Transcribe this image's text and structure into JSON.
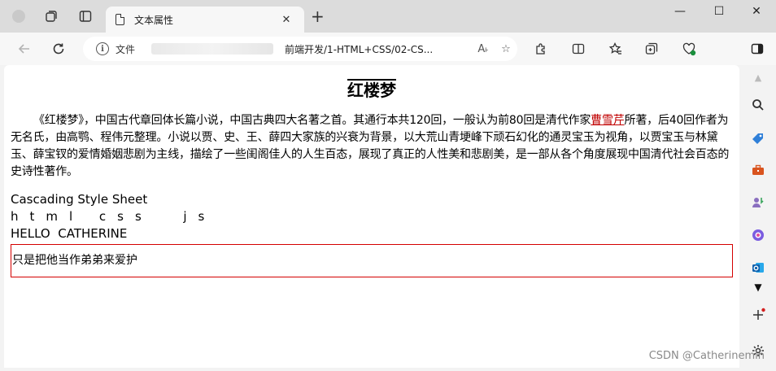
{
  "browser": {
    "tab_title": "文本属性",
    "tab_close": "✕",
    "new_tab": "+",
    "omnibox": {
      "security_label": "文件",
      "url_visible": "前端开发/1-HTML+CSS/02-CS...",
      "read_aloud": "A˫",
      "favorite": "☆"
    },
    "window_controls": {
      "minimize": "—",
      "maximize": "☐",
      "close": "✕"
    }
  },
  "page": {
    "title": "红楼梦",
    "intro_text": "《红楼梦》，中国古代章回体长篇小说，中国古典四大名著之首。其通行本共120回，一般认为前80回是清代作家",
    "intro_link": "曹雪芹",
    "intro_rest": "所著，后40回作者为无名氏，由高鹗、程伟元整理。小说以贾、史、王、薛四大家族的兴衰为背景，以大荒山青埂峰下顽石幻化的通灵宝玉为视角，以贾宝玉与林黛玉、薛宝钗的爱情婚姻悲剧为主线，描绘了一些闺阁佳人的人生百态，展现了真正的人性美和悲剧美，是一部从各个角度展现中国清代社会百态的史诗性著作。",
    "line_css": "Cascading Style Sheet",
    "line_spaced": "html css  js",
    "line_upper": "HELLO  CATHERINE",
    "boxed_text": "只是把他当作弟弟来爱护"
  },
  "watermark": "CSDN @Catherinemin",
  "colors": {
    "link": "#c00000",
    "box_border": "#d40000",
    "tab_strip": "#dcdcdc"
  },
  "icons": [
    "workspaces-icon",
    "tab-actions-icon",
    "document-icon",
    "back-icon",
    "refresh-icon",
    "info-icon",
    "favorite-icon",
    "extensions-icon",
    "split-screen-icon",
    "favorites-icon",
    "collections-icon",
    "browser-essentials-icon",
    "sidebar-toggle-icon",
    "search-icon",
    "shopping-icon",
    "tools-icon",
    "people-icon",
    "copilot-icon",
    "outlook-icon",
    "add-icon",
    "settings-icon"
  ]
}
